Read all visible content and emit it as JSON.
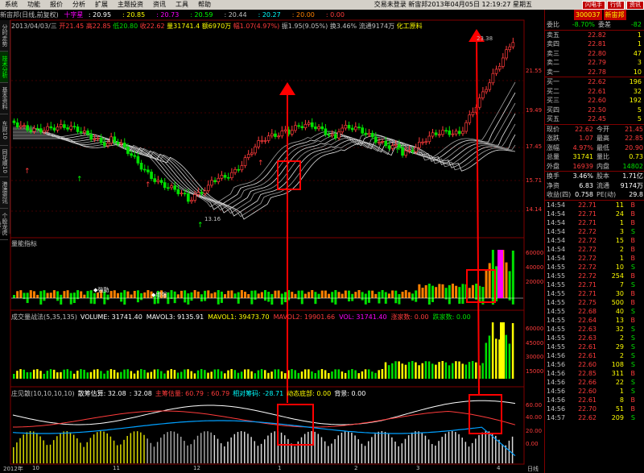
{
  "menu": {
    "items": [
      "系统",
      "功能",
      "报价",
      "分析",
      "扩展",
      "主题投资",
      "资讯",
      "工具",
      "帮助"
    ],
    "center": "交易未登录  新宙邦2013年04月05日 12:19:27 星期五",
    "badges": [
      "闪电手",
      "行情",
      "资讯"
    ]
  },
  "infobar": {
    "name": "新宙邦(日线,前复权)",
    "star": "十字星",
    "vals": [
      "20.95",
      "20.85",
      "20.73",
      "20.59",
      "20.44",
      "20.27",
      "20.00",
      "0.00"
    ]
  },
  "ohlc": {
    "date": "2013/04/03/三",
    "open": "开21.45",
    "high": "高22.85",
    "low": "低20.80",
    "close": "收22.62",
    "vol": "量31741.4",
    "amt": "额6970万",
    "chg": "幅1.07(4.97%)",
    "swing": "振1.95(9.05%)",
    "turnover": "换3.46%",
    "float": "流通9174万",
    "sector": "化工原料"
  },
  "sidetabs": [
    "分时走势",
    "技术分析",
    "基本资料",
    "东财10",
    "同花顺10",
    "港澳资讯",
    "个股龙虎榜"
  ],
  "main_axis": [
    "21.55",
    "19.49",
    "17.45",
    "15.71",
    "14.14"
  ],
  "annot": {
    "high": "23.38",
    "low": "13.16"
  },
  "vol_panel": {
    "title": "量能指标",
    "axis": [
      "60000",
      "40000",
      "20000"
    ],
    "labels": [
      "◆強勁",
      "◆增强"
    ]
  },
  "vw_panel": {
    "title": "成交量战法(5,35,135)",
    "items": [
      {
        "t": "VOLUME: 31741.40",
        "c": "#ffffff"
      },
      {
        "t": "MAVOL3: 9135.91",
        "c": "#ffffff"
      },
      {
        "t": "MAVOL1: 39473.70",
        "c": "#ffff00"
      },
      {
        "t": "MAVOL2: 19901.66",
        "c": "#ff3b3b"
      },
      {
        "t": "VOL: 31741.40",
        "c": "#ff00ff"
      },
      {
        "t": "涨家数: 0.00",
        "c": "#ff3b3b"
      },
      {
        "t": "跌家数: 0.00",
        "c": "#00e000"
      }
    ],
    "axis": [
      "60000",
      "45000",
      "30000",
      "15000"
    ]
  },
  "ind_panel": {
    "title": "庄见散(10,10,10,10)",
    "items": [
      {
        "t": "散筹估算: 32.08",
        "c": "#ffffff"
      },
      {
        "t": ": 32.08",
        "c": "#ffffff"
      },
      {
        "t": "主筹估量: 60.79",
        "c": "#ff3b3b"
      },
      {
        "t": ": 60.79",
        "c": "#ff3b3b"
      },
      {
        "t": "相对筹码: -28.71",
        "c": "#00ffff"
      },
      {
        "t": "动态底部: 0.00",
        "c": "#ffff00"
      },
      {
        "t": "背景: 0.00",
        "c": "#ffffff"
      }
    ],
    "axis": [
      "60.00",
      "40.00",
      "20.00",
      "0.00"
    ]
  },
  "bottom_axis": {
    "labels": [
      "2012年",
      "10",
      "11",
      "12",
      "1",
      "2",
      "3",
      "4"
    ],
    "right": "日线"
  },
  "quote": {
    "code": "300037",
    "name": "新宙邦",
    "weibi": "委比",
    "weibi_val": "-8.70%",
    "weicha": "委差",
    "weicha_val": "-82",
    "asks": [
      {
        "l": "卖五",
        "p": "22.82",
        "v": "1"
      },
      {
        "l": "卖四",
        "p": "22.81",
        "v": "1"
      },
      {
        "l": "卖三",
        "p": "22.80",
        "v": "47"
      },
      {
        "l": "卖二",
        "p": "22.79",
        "v": "3"
      },
      {
        "l": "卖一",
        "p": "22.78",
        "v": "10"
      }
    ],
    "bids": [
      {
        "l": "买一",
        "p": "22.62",
        "v": "196"
      },
      {
        "l": "买二",
        "p": "22.61",
        "v": "32"
      },
      {
        "l": "买三",
        "p": "22.60",
        "v": "192"
      },
      {
        "l": "买四",
        "p": "22.50",
        "v": "5"
      },
      {
        "l": "买五",
        "p": "22.45",
        "v": "5"
      }
    ],
    "stats": [
      {
        "a": "现价",
        "av": "22.62",
        "ac": "#ff3b3b",
        "b": "今开",
        "bv": "21.45",
        "bc": "#ff3b3b"
      },
      {
        "a": "涨跌",
        "av": "1.07",
        "ac": "#ff3b3b",
        "b": "最高",
        "bv": "22.85",
        "bc": "#ff3b3b"
      },
      {
        "a": "涨幅",
        "av": "4.97%",
        "ac": "#ff3b3b",
        "b": "最低",
        "bv": "20.90",
        "bc": "#ff3b3b"
      },
      {
        "a": "总量",
        "av": "31741",
        "ac": "#ffff00",
        "b": "量比",
        "bv": "0.73",
        "bc": "#ffff00"
      },
      {
        "a": "外盘",
        "av": "16939",
        "ac": "#ff3b3b",
        "b": "内盘",
        "bv": "14802",
        "bc": "#00e000"
      }
    ],
    "stats2": [
      {
        "a": "换手",
        "av": "3.46%",
        "b": "股本",
        "bv": "1.71亿"
      },
      {
        "a": "净资",
        "av": "6.83",
        "b": "流通",
        "bv": "9174万"
      },
      {
        "a": "收益(四)",
        "av": "0.758",
        "b": "PE(动)",
        "bv": "29.8"
      }
    ],
    "ticks": [
      {
        "t": "14:54",
        "p": "22.71",
        "v": "11",
        "s": "B"
      },
      {
        "t": "14:54",
        "p": "22.71",
        "v": "24",
        "s": "B"
      },
      {
        "t": "14:54",
        "p": "22.71",
        "v": "1",
        "s": "B"
      },
      {
        "t": "14:54",
        "p": "22.72",
        "v": "3",
        "s": "S"
      },
      {
        "t": "14:54",
        "p": "22.72",
        "v": "15",
        "s": "B"
      },
      {
        "t": "14:54",
        "p": "22.72",
        "v": "2",
        "s": "B"
      },
      {
        "t": "14:54",
        "p": "22.72",
        "v": "1",
        "s": "B"
      },
      {
        "t": "14:55",
        "p": "22.72",
        "v": "10",
        "s": "S"
      },
      {
        "t": "14:55",
        "p": "22.72",
        "v": "254",
        "s": "B"
      },
      {
        "t": "14:55",
        "p": "22.71",
        "v": "7",
        "s": "S"
      },
      {
        "t": "14:55",
        "p": "22.71",
        "v": "30",
        "s": "B"
      },
      {
        "t": "14:55",
        "p": "22.75",
        "v": "500",
        "s": "B"
      },
      {
        "t": "14:55",
        "p": "22.68",
        "v": "40",
        "s": "S"
      },
      {
        "t": "14:55",
        "p": "22.64",
        "v": "13",
        "s": "B"
      },
      {
        "t": "14:55",
        "p": "22.63",
        "v": "32",
        "s": "S"
      },
      {
        "t": "14:55",
        "p": "22.63",
        "v": "2",
        "s": "S"
      },
      {
        "t": "14:55",
        "p": "22.61",
        "v": "29",
        "s": "S"
      },
      {
        "t": "14:56",
        "p": "22.61",
        "v": "2",
        "s": "S"
      },
      {
        "t": "14:56",
        "p": "22.60",
        "v": "108",
        "s": "S"
      },
      {
        "t": "14:56",
        "p": "22.85",
        "v": "311",
        "s": "B"
      },
      {
        "t": "14:56",
        "p": "22.66",
        "v": "22",
        "s": "S"
      },
      {
        "t": "14:56",
        "p": "22.60",
        "v": "1",
        "s": "S"
      },
      {
        "t": "14:56",
        "p": "22.61",
        "v": "8",
        "s": "B"
      },
      {
        "t": "14:56",
        "p": "22.70",
        "v": "51",
        "s": "B"
      },
      {
        "t": "14:57",
        "p": "22.62",
        "v": "209",
        "s": "S"
      }
    ]
  },
  "colors": {
    "up": "#ff3b3b",
    "down": "#00e000",
    "frame": "#800000",
    "highlight": "#ff0000"
  }
}
